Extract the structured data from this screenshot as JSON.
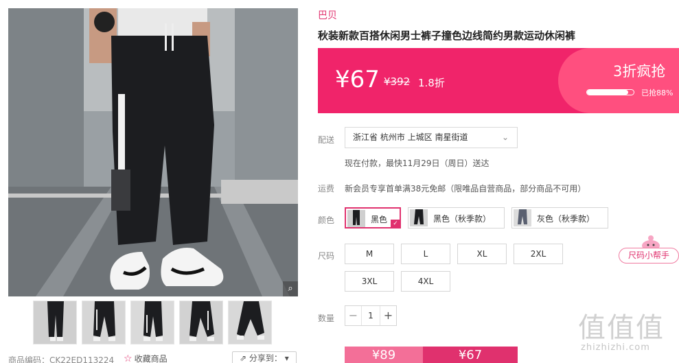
{
  "product": {
    "brand": "巴贝",
    "title": "秋装新款百搭休闲男士裤子撞色边线简约男款运动休闲裤"
  },
  "price": {
    "current": "¥67",
    "original": "¥392",
    "discount": "1.8折",
    "flash_title": "3折疯抢",
    "sold_label": "已抢88%",
    "sold_fraction": 0.88
  },
  "delivery": {
    "label": "配送",
    "address": "浙江省 杭州市 上城区 南星街道",
    "eta": "现在付款，最快11月29日（周日）送达"
  },
  "shipping": {
    "label": "运费",
    "text": "新会员专享首单满38元免邮（限唯品自营商品，部分商品不可用）"
  },
  "color": {
    "label": "颜色",
    "options": [
      {
        "label": "黑色",
        "selected": true
      },
      {
        "label": "黑色（秋季款）",
        "selected": false
      },
      {
        "label": "灰色（秋季款）",
        "selected": false
      }
    ]
  },
  "size": {
    "label": "尺码",
    "options": [
      "M",
      "L",
      "XL",
      "2XL",
      "3XL",
      "4XL"
    ],
    "helper": "尺码小帮手"
  },
  "quantity": {
    "label": "数量",
    "value": "1",
    "minus": "−",
    "plus": "+"
  },
  "buy": {
    "normal_price": "¥89",
    "flash_price": "¥67"
  },
  "gallery": {
    "product_code": "商品编码：CK22ED113224",
    "favorite": "收藏商品",
    "share": "分享到："
  },
  "watermark": {
    "glyphs": "值值值",
    "url": "zhizhizhi.com"
  },
  "colors": {
    "accent": "#e0316e",
    "banner": "#f0246a"
  }
}
